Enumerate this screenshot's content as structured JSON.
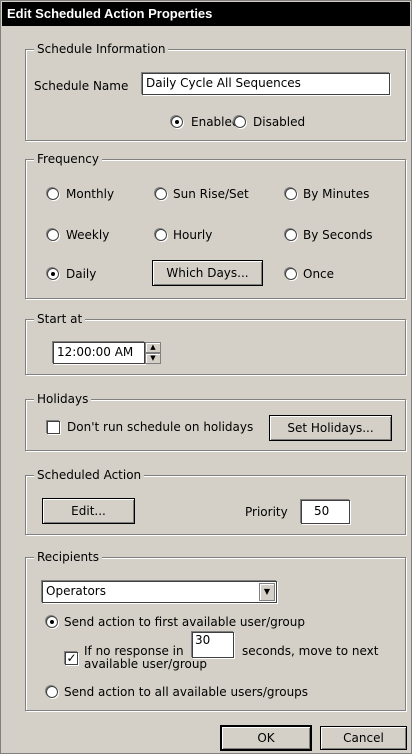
{
  "window": {
    "title": "Edit Scheduled Action Properties"
  },
  "schedule_info": {
    "legend": "Schedule Information",
    "name_label": "Schedule Name",
    "name_value": "Daily Cycle All Sequences",
    "enabled_label": "Enabled",
    "disabled_label": "Disabled",
    "selected": "Enabled"
  },
  "frequency": {
    "legend": "Frequency",
    "options": [
      "Monthly",
      "Sun Rise/Set",
      "By Minutes",
      "Weekly",
      "Hourly",
      "By Seconds",
      "Daily",
      "Once"
    ],
    "selected": "Daily",
    "which_days_button": "Which Days..."
  },
  "start_at": {
    "legend": "Start at",
    "time": "12:00:00 AM"
  },
  "holidays": {
    "legend": "Holidays",
    "checkbox_label": "Don't run schedule on holidays",
    "checked": false,
    "set_holidays_button": "Set Holidays..."
  },
  "scheduled_action": {
    "legend": "Scheduled Action",
    "edit_button": "Edit...",
    "priority_label": "Priority",
    "priority_value": "50"
  },
  "recipients": {
    "legend": "Recipients",
    "selected_group": "Operators",
    "option_first": "Send action to first available user/group",
    "no_response_prefix": "If no response in",
    "no_response_seconds": "30",
    "no_response_suffix": "seconds, move to next",
    "no_response_line2": "available user/group",
    "no_response_checked": true,
    "option_all": "Send action to all available users/groups",
    "selected": "first"
  },
  "footer": {
    "ok": "OK",
    "cancel": "Cancel"
  }
}
